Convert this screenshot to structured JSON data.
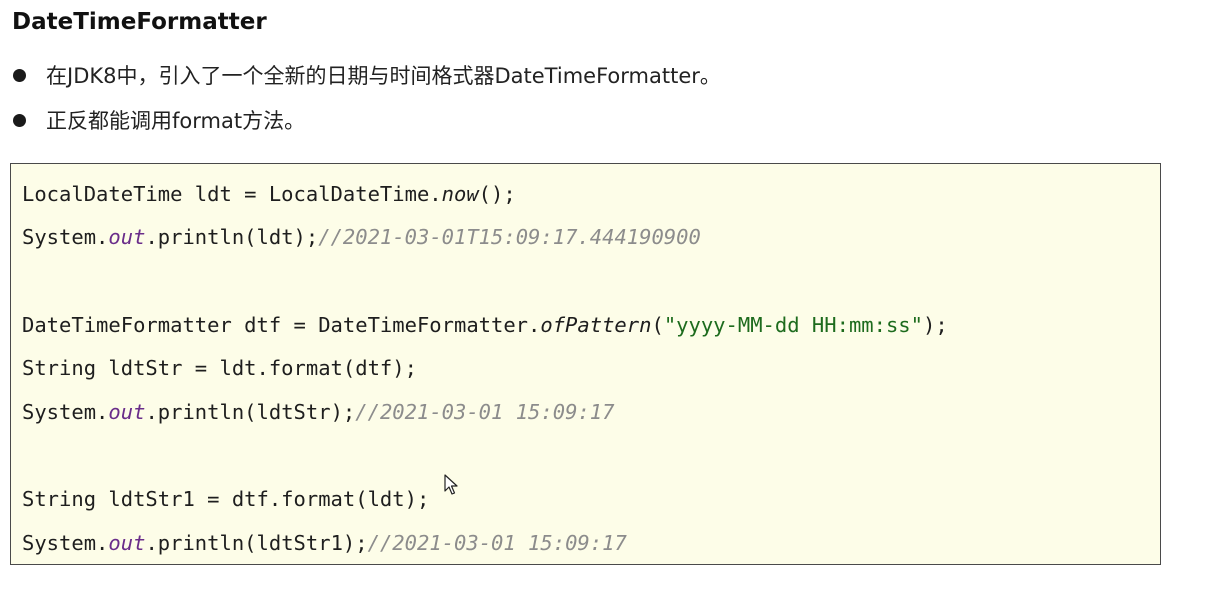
{
  "title": "DateTimeFormatter",
  "bullets": [
    "在JDK8中，引入了一个全新的日期与时间格式器DateTimeFormatter。",
    "正反都能调用format方法。"
  ],
  "code": {
    "l1_a": "LocalDateTime ldt = LocalDateTime.",
    "l1_b": "now",
    "l1_c": "();",
    "l2_a": "System.",
    "l2_b": "out",
    "l2_c": ".println(ldt);",
    "l2_d": "//2021-03-01T15:09:17.444190900",
    "l3_a": "DateTimeFormatter dtf = DateTimeFormatter.",
    "l3_b": "ofPattern",
    "l3_c": "(",
    "l3_d": "\"yyyy-MM-dd HH:mm:ss\"",
    "l3_e": ");",
    "l4": "String ldtStr = ldt.format(dtf);",
    "l5_a": "System.",
    "l5_b": "out",
    "l5_c": ".println(ldtStr);",
    "l5_d": "//2021-03-01 15:09:17",
    "l6": "String ldtStr1 = dtf.format(ldt);",
    "l7_a": "System.",
    "l7_b": "out",
    "l7_c": ".println(ldtStr1);",
    "l7_d": "//2021-03-01 15:09:17"
  },
  "colors": {
    "code_background": "#fdfde8",
    "field": "#6a2d8a",
    "comment": "#8c8c8c",
    "string": "#1d6b1d"
  }
}
